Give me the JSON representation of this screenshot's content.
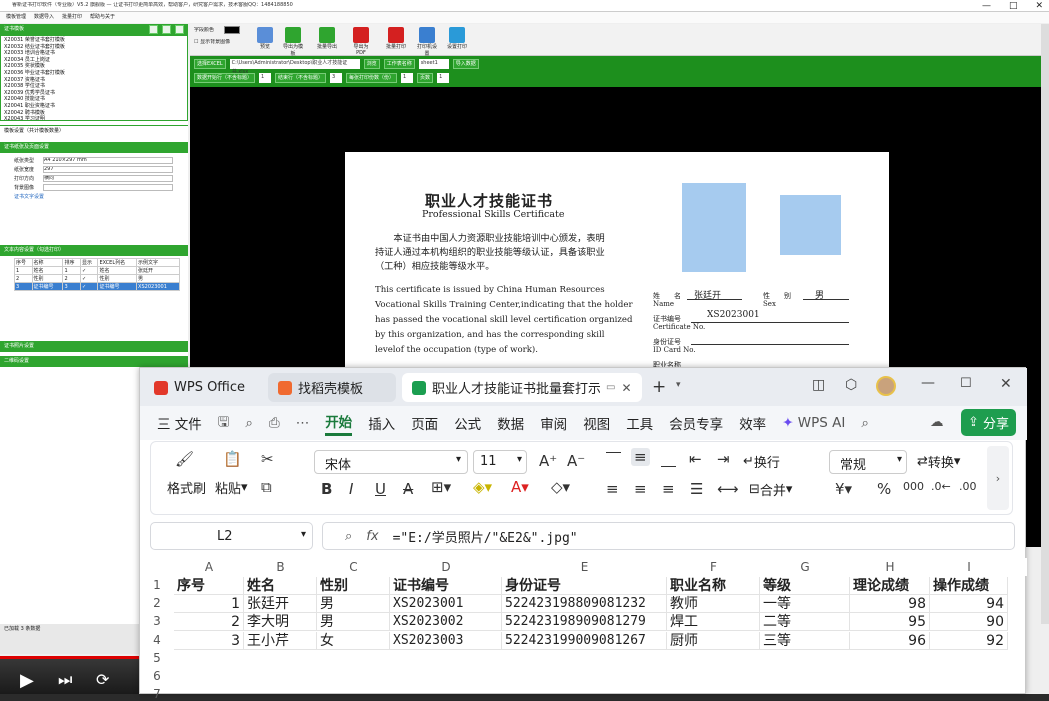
{
  "old_app": {
    "title": "睿新证书打印软件（专业版）V5.2 旗舰版 — 让证书打印更简单高效，帮助客户，研究客户需求，技术客服QQ：1484188850",
    "menu": [
      "模板管理",
      "数据导入",
      "批量打印",
      "帮助与关于"
    ],
    "sidebar": {
      "header": "证书模板",
      "categories": [
        "X20031 荣誉证书套打模板",
        "X20032 结业证书套打模板",
        "X20033 培训合格证书",
        "X20034 员工上岗证",
        "X20035 奖状模板",
        "X20036 毕业证书套打模板",
        "X20037 资格证书",
        "X20038 学位证书",
        "X20039 优秀学员证书",
        "X20040 技能证书",
        "X20041 职业资格证书",
        "X20042 聘书模板",
        "X20043 学习证明",
        "X20044 职业人才技能证书"
      ],
      "section_header": "模板设置（共计模板数量）",
      "page_header": "证书纸张及页面设置",
      "form": [
        {
          "label": "纸张类型",
          "value": "A4 210×297 mm"
        },
        {
          "label": "纸张宽度",
          "value": "297"
        },
        {
          "label": "打印方向",
          "value": "横向"
        },
        {
          "label": "背景图像",
          "value": ""
        }
      ],
      "text_header": "证书文字设置",
      "text_section": "文本内容设置（勾选打印）",
      "bottom_sections": [
        "证书照片设置",
        "二维码设置"
      ],
      "field_table": {
        "headers": [
          "序号",
          "名称",
          "排序",
          "显示",
          "EXCEL列名",
          "示例文字"
        ],
        "rows": [
          [
            "1",
            "姓名",
            "1",
            "✓",
            "姓名",
            "张廷开"
          ],
          [
            "2",
            "性别",
            "2",
            "✓",
            "性别",
            "男"
          ],
          [
            "3",
            "证书编号",
            "3",
            "✓",
            "证书编号",
            "XS2023001"
          ]
        ]
      },
      "status": "已加载 3 条数据"
    },
    "toolbar": {
      "field_color_label": "字段颜色",
      "show_bg_label": "显示背景图像",
      "buttons": [
        "预览",
        "导出为模板",
        "批量导出",
        "导出为PDF",
        "批量打印",
        "打印机设置",
        "设置打印"
      ]
    },
    "green_panel": {
      "excel_label": "选择EXCEL",
      "excel_path": "C:\\Users\\Administrator\\Desktop\\职业人才技能证书.xlsx",
      "browse": "浏览",
      "sheet_label": "工作表名称",
      "sheet_value": "sheet1",
      "import_btn": "导入数据",
      "row_label": "数据开始行（不含标题）",
      "row_value": "1",
      "end_label": "结束行（不含标题）",
      "end_value": "3",
      "copies_label": "每张打印份数（份）",
      "copies_value": "1",
      "page_label": "页数",
      "page_value": "1"
    },
    "certificate": {
      "title_zh": "职业人才技能证书",
      "title_en": "Professional Skills Certificate",
      "body_zh": "本证书由中国人力资源职业技能培训中心颁发，表明持证人通过本机构组织的职业技能等级认证，具备该职业（工种）相应技能等级水平。",
      "body_en": "This certificate is issued by China Human Resources Vocational Skills Training Center,indicating that the holder has passed the vocational skill level certification organized by this organization, and has the corresponding skill levelof the occupation (type of work).",
      "name_label": "姓　　名",
      "name_en": "Name",
      "name_value": "张廷开",
      "sex_label": "性　　别",
      "sex_en": "Sex",
      "sex_value": "男",
      "certno_label": "证书编号",
      "certno_en": "Certificate No.",
      "certno_value": "XS2023001",
      "id_label": "身份证号",
      "id_en": "ID Card No.",
      "job_label": "职业名称"
    }
  },
  "wps": {
    "tabs": [
      "WPS Office",
      "找稻壳模板",
      "职业人才技能证书批量套打示例"
    ],
    "new_tab": "+",
    "menu": [
      "三 文件",
      "开始",
      "插入",
      "页面",
      "公式",
      "数据",
      "审阅",
      "视图",
      "工具",
      "会员专享",
      "效率"
    ],
    "wps_ai": "WPS AI",
    "share": "分享",
    "ribbon": {
      "format_painter": "格式刷",
      "paste": "粘贴",
      "font": "宋体",
      "size": "11",
      "wrap": "换行",
      "merge": "合并",
      "number_format": "常规",
      "convert": "转换"
    },
    "name_box": "L2",
    "formula": "=\"E:/学员照片/\"&E2&\".jpg\"",
    "columns": [
      "A",
      "B",
      "C",
      "D",
      "E",
      "F",
      "G",
      "H",
      "I"
    ],
    "row_numbers": [
      "1",
      "2",
      "3",
      "4",
      "5",
      "6",
      "7"
    ],
    "header_row": [
      "序号",
      "姓名",
      "性别",
      "证书编号",
      "身份证号",
      "职业名称",
      "等级",
      "理论成绩",
      "操作成绩"
    ],
    "rows": [
      [
        "1",
        "张廷开",
        "男",
        "XS2023001",
        "522423198809081232",
        "教师",
        "一等",
        "98",
        "94"
      ],
      [
        "2",
        "李大明",
        "男",
        "XS2023002",
        "522423198909081279",
        "焊工",
        "二等",
        "95",
        "90"
      ],
      [
        "3",
        "王小芹",
        "女",
        "XS2023003",
        "522423199009081267",
        "厨师",
        "三等",
        "96",
        "92"
      ]
    ]
  }
}
